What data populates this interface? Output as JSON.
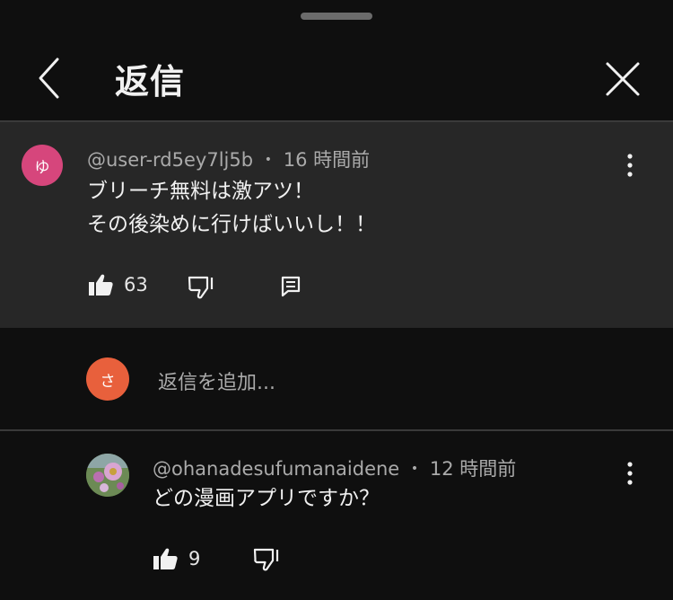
{
  "header": {
    "title": "返信"
  },
  "parent_comment": {
    "avatar_letter": "ゆ",
    "avatar_color": "#d6467c",
    "author": "@user-rd5ey7lj5b",
    "separator": "•",
    "time": "16 時間前",
    "lines": [
      "ブリーチ無料は激アツ！",
      "その後染めに行けばいいし！！"
    ],
    "likes": "63"
  },
  "add_reply": {
    "avatar_letter": "さ",
    "avatar_color": "#e8603c",
    "placeholder": "返信を追加..."
  },
  "reply": {
    "author": "@ohanadesufumanaidene",
    "separator": "•",
    "time": "12 時間前",
    "text": "どの漫画アプリですか？",
    "likes": "9"
  },
  "colors": {
    "background": "#0f0f0f",
    "highlight": "#272727",
    "text": "#f1f1f1",
    "secondary": "#aaaaaa"
  }
}
